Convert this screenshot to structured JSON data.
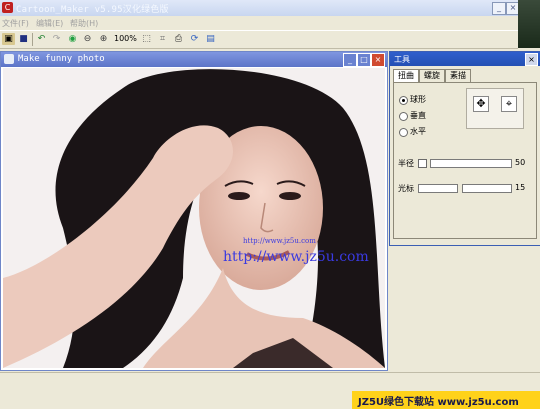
{
  "app": {
    "title": "Cartoon_Maker v5.95汉化绿色版",
    "minimize": "_",
    "close": "×"
  },
  "menu": [
    "文件(F)",
    "编辑(E)",
    "帮助(H)"
  ],
  "toolbar": {
    "zoom": "100%"
  },
  "image_window": {
    "title": "Make funny photo",
    "min": "_",
    "max": "□",
    "close": "×",
    "watermark_small": "http://www.jz5u.com",
    "watermark": "http://www.jz5u.com"
  },
  "tool_window": {
    "title": "工具",
    "close": "×",
    "tabs": [
      "扭曲",
      "螺旋",
      "素描"
    ],
    "active_tab": "扭曲",
    "modes": [
      "球形",
      "垂直",
      "水平"
    ],
    "selected_mode": "球形",
    "radius_label": "半径",
    "radius_value": "50",
    "cursor_label": "光标",
    "cursor_value": "15"
  },
  "banner": {
    "text": "JZ5U绿色下载站 www.jz5u.com"
  },
  "colors": {
    "toolwin_title": "#2f5fcc",
    "imgwin_title": "#5c74c8",
    "banner": "#ffd21a"
  }
}
